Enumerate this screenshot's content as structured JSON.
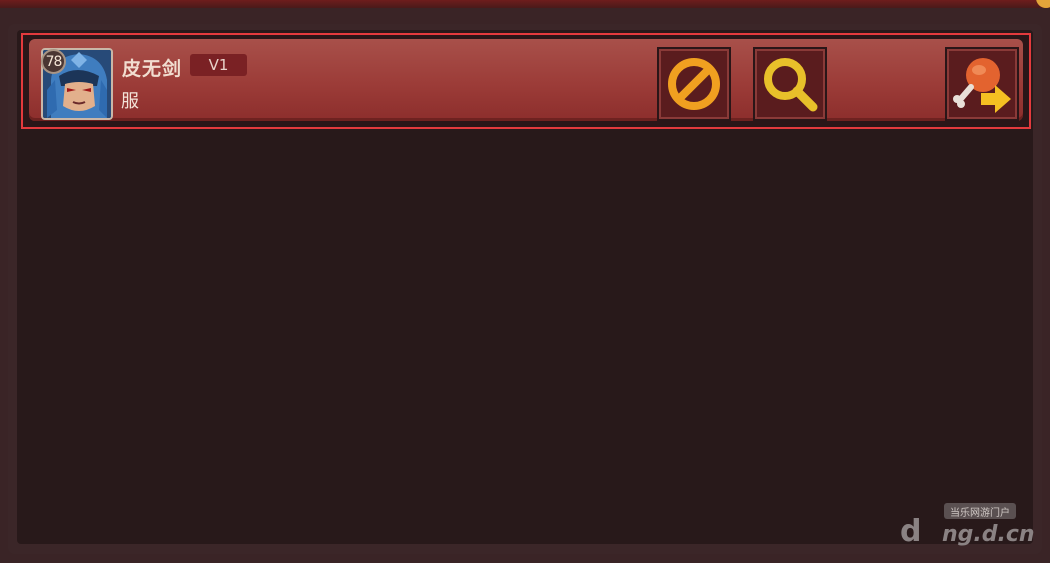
{
  "friend": {
    "level": "78",
    "name": "皮无剑",
    "vip": "V1",
    "server": "服"
  },
  "actions": {
    "block_icon": "block-icon",
    "search_icon": "search-icon",
    "gift_icon": "drumstick-send-icon"
  },
  "watermark": {
    "badge": "当乐网游门户",
    "site": "ng.d.cn",
    "logo": "d"
  },
  "colors": {
    "row_border": "#e33a3d",
    "row_fill": "#9c3c38",
    "panel_bg": "#28191a",
    "icon_orange": "#f0a020"
  }
}
